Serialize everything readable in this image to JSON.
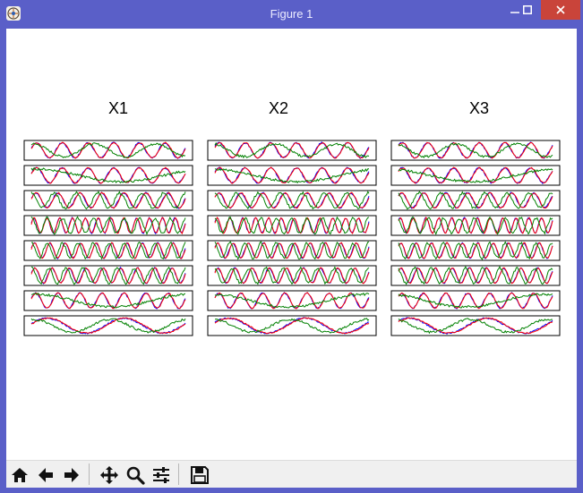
{
  "window": {
    "title": "Figure 1",
    "min_icon": "minimize-icon",
    "max_icon": "maximize-icon",
    "close_icon": "close-icon",
    "close_color": "#c9443a",
    "titlebar_color": "#5a5fc8"
  },
  "figure": {
    "columns": [
      {
        "title": "X1"
      },
      {
        "title": "X2"
      },
      {
        "title": "X3"
      }
    ]
  },
  "chart_data": {
    "type": "line",
    "layout": "3 columns x 8 rows of small line plots, no axis labels or tick labels",
    "series_colors": [
      "#0000ff",
      "#ff0000",
      "#008000"
    ],
    "series_colors_note": "blue and red sinusoids overlap closely; green is a lower-frequency or phase-shifted trace",
    "rows": [
      {
        "row": 1,
        "blue_cycles": 6,
        "green_cycles": 2.5
      },
      {
        "row": 2,
        "blue_cycles": 6,
        "green_cycles": 0.9
      },
      {
        "row": 3,
        "blue_cycles": 7,
        "green_cycles": 7
      },
      {
        "row": 4,
        "blue_cycles": 12,
        "green_cycles": 10
      },
      {
        "row": 5,
        "blue_cycles": 10,
        "green_cycles": 10
      },
      {
        "row": 6,
        "blue_cycles": 9,
        "green_cycles": 9
      },
      {
        "row": 7,
        "blue_cycles": 7,
        "green_cycles": 1
      },
      {
        "row": 8,
        "blue_cycles": 2,
        "green_cycles": 2
      }
    ],
    "grid": false,
    "legend": "none"
  },
  "toolbar": {
    "buttons": [
      {
        "name": "home-icon"
      },
      {
        "name": "back-arrow-icon"
      },
      {
        "name": "forward-arrow-icon"
      },
      {
        "name": "pan-icon"
      },
      {
        "name": "zoom-icon"
      },
      {
        "name": "configure-subplots-icon"
      },
      {
        "name": "save-icon"
      }
    ]
  }
}
